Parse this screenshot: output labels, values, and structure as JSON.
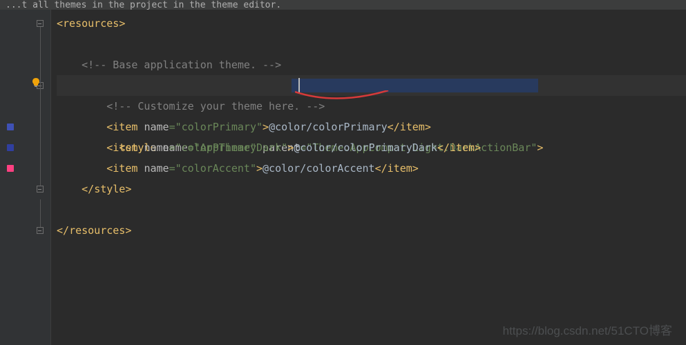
{
  "topBar": "...t all themes in the project in the theme editor.",
  "gutter": {
    "lines": [
      "",
      "",
      "",
      "",
      "",
      "",
      "",
      "",
      "",
      ""
    ],
    "swatches": [
      {
        "line": 6,
        "color": "#3F51B5"
      },
      {
        "line": 7,
        "color": "#303F9F"
      },
      {
        "line": 8,
        "color": "#FF4081"
      }
    ]
  },
  "code": {
    "l1_tag": "resources",
    "l3_comment": "<!-- Base application theme. -->",
    "l4": {
      "tag": "style",
      "attr_name": "name",
      "name_val": "AppTheme",
      "attr_parent": "parent",
      "parent_val": "Theme.AppCompat.Light.DarkActionBar"
    },
    "l5_comment": "<!-- Customize your theme here. -->",
    "l6": {
      "tag": "item",
      "attr": "name",
      "name_val": "colorPrimary",
      "ref": "@color/colorPrimary"
    },
    "l7": {
      "tag": "item",
      "attr": "name",
      "name_val": "colorPrimaryDark",
      "ref": "@color/colorPrimaryDark"
    },
    "l8": {
      "tag": "item",
      "attr": "name",
      "name_val": "colorAccent",
      "ref": "@color/colorAccent"
    },
    "l9_close": "style",
    "l11_close": "resources"
  },
  "watermark": "https://blog.csdn.net/51CTO博客"
}
